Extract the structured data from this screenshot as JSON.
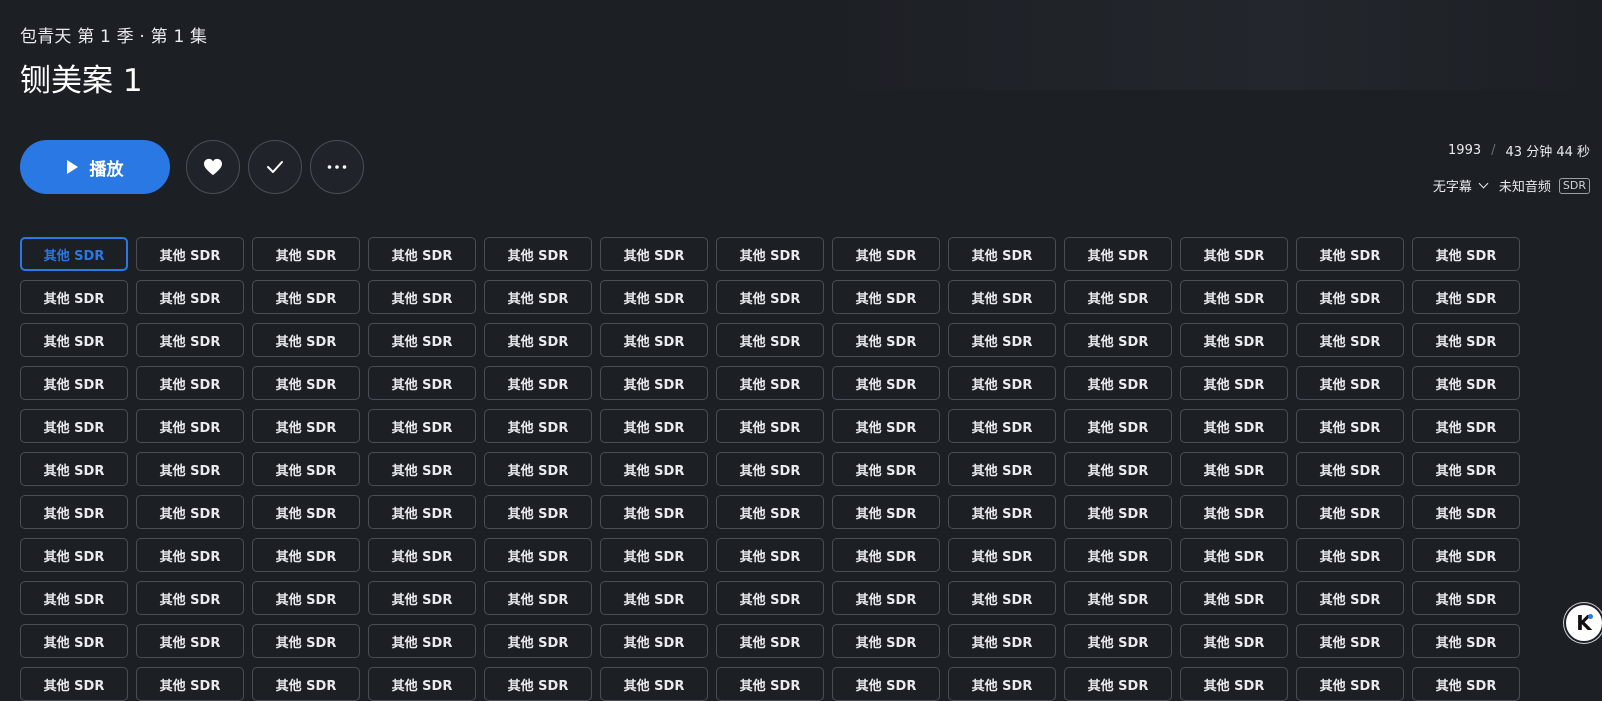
{
  "header": {
    "subtitle": "包青天 第 1 季 · 第 1 集",
    "title": "铡美案 1"
  },
  "actions": {
    "play_label": "播放"
  },
  "meta": {
    "year": "1993",
    "separator": "/",
    "duration": "43 分钟 44 秒",
    "subtitles_label": "无字幕",
    "audio_label": "未知音频",
    "badge": "SDR"
  },
  "versions": {
    "label": "其他 SDR",
    "columns": 13,
    "visible_rows": 11,
    "selected_index": 0
  },
  "colors": {
    "accent": "#2a78e4",
    "background": "#1c1f24",
    "border": "#4a4f57"
  },
  "icons": {
    "play": "play-icon",
    "favorite": "heart-icon",
    "watched": "check-icon",
    "more": "more-icon",
    "dropdown": "chevron-down-icon",
    "floating": "k-logo-icon"
  }
}
